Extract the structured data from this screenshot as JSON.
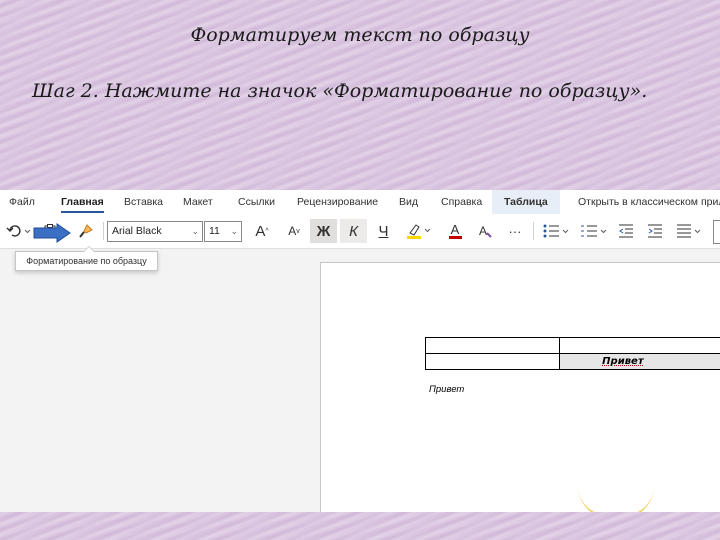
{
  "slide": {
    "title": "Форматируем текст по образцу",
    "step": "Шаг 2. Нажмите на значок «Форматирование по образцу»."
  },
  "ribbon": {
    "tabs": [
      {
        "label": "Файл"
      },
      {
        "label": "Главная"
      },
      {
        "label": "Вставка"
      },
      {
        "label": "Макет"
      },
      {
        "label": "Ссылки"
      },
      {
        "label": "Рецензирование"
      },
      {
        "label": "Вид"
      },
      {
        "label": "Справка"
      },
      {
        "label": "Таблица"
      }
    ],
    "active_tab": "Главная",
    "open_desktop_label": "Открыть в классическом прил"
  },
  "toolbar": {
    "undo_icon": "undo-icon",
    "clipboard_icon": "clipboard-icon",
    "format_painter_icon": "format-painter-icon",
    "font_name": "Arial Black",
    "font_size": "11",
    "grow_font": "A",
    "shrink_font": "A",
    "bold": "Ж",
    "italic": "К",
    "underline": "Ч",
    "highlight_icon": "highlighter-icon",
    "font_color_letter": "A",
    "clear_format_icon": "clear-formatting-icon",
    "more": "···",
    "bullets_icon": "bullets-icon",
    "numbering_icon": "numbering-icon",
    "decrease_indent_icon": "decrease-indent-icon",
    "increase_indent_icon": "increase-indent-icon",
    "align_icon": "align-icon"
  },
  "tooltip": {
    "text": "Форматирование по образцу"
  },
  "document": {
    "table_cell_text": "Привет",
    "paragraph_text": "Привет"
  },
  "colors": {
    "accent": "#2b579a",
    "highlight": "#ffd700",
    "font_color": "#c00000",
    "arrow": "#3a6fc4"
  }
}
